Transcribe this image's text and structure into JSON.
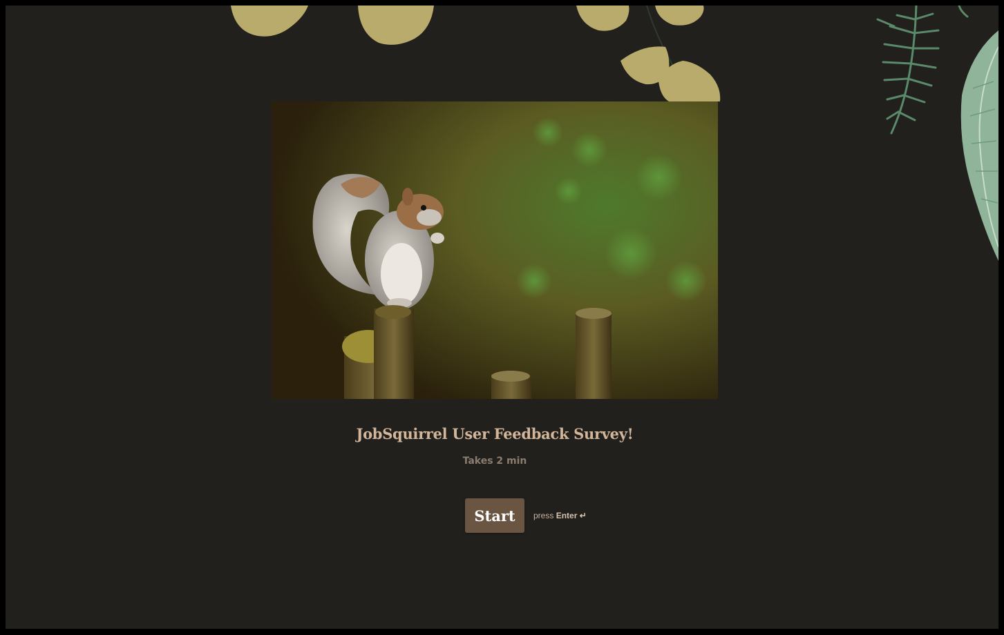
{
  "survey": {
    "title": "JobSquirrel User Feedback Survey!",
    "duration": "Takes 2 min",
    "start_label": "Start",
    "hint_prefix": "press",
    "hint_key": "Enter",
    "hint_key_icon": "↵"
  },
  "images": {
    "hero": "squirrel-on-wooden-post-photo",
    "decorations": [
      "ginkgo-leaves",
      "fern-frond",
      "feather-leaf"
    ]
  },
  "colors": {
    "background": "#22201d",
    "title": "#d3b69a",
    "subtitle": "#8b7d70",
    "button": "#6a5542",
    "button_text": "#ffffff"
  }
}
